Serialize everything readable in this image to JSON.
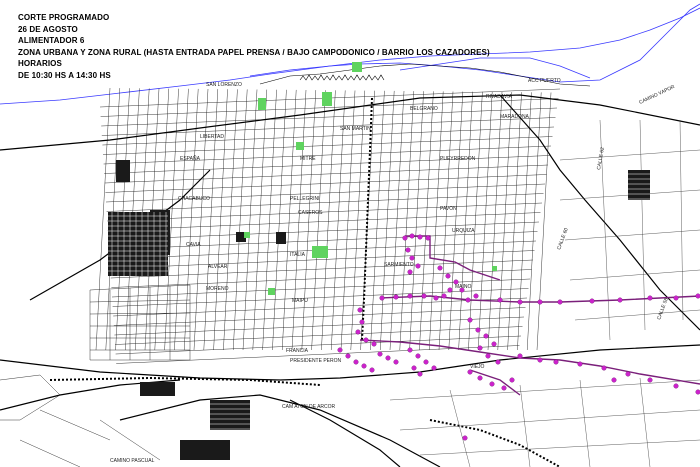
{
  "notice": {
    "line1": "CORTE PROGRAMADO",
    "line2": "26 DE AGOSTO",
    "line3": "ALIMENTADOR 6",
    "line4": "ZONA URBANA Y ZONA RURAL (HASTA ENTRADA PAPEL PRENSA / BAJO CAMPODONICO / BARRIO LOS CAZADORES)",
    "line5": "HORARIOS",
    "line6": "DE 10:30 HS A 14:30 HS"
  },
  "streets": [
    "SAN LORENZO",
    "SAN MARTIN",
    "BELGRANO",
    "MITRE",
    "ESPAÑA",
    "LIBERTAD",
    "PUEYRREDON",
    "CHACABUCO",
    "PELLEGRINI",
    "ALVEAR",
    "MAIPU",
    "MORENO",
    "ITALIA",
    "FRANCIA",
    "MAINO",
    "VIEJO",
    "PAVON",
    "ACC PUERTO",
    "CAMINO VAPOR",
    "CALLE 62",
    "CALLE 60",
    "CALLE 58",
    "CAM ATON DE ARCOR",
    "CAMINO PASCUAL",
    "PRESIDENTE PERON",
    "CASEROS",
    "CAVIA",
    "URQUIZA",
    "RIVADAVIA",
    "MARADONA",
    "SARMIENTO"
  ],
  "colors": {
    "river": "#3a3aff",
    "roads": "#111111",
    "affected_points": "#cc22cc",
    "affected_line": "#7a1f7a",
    "parks": "#5fd35f"
  }
}
